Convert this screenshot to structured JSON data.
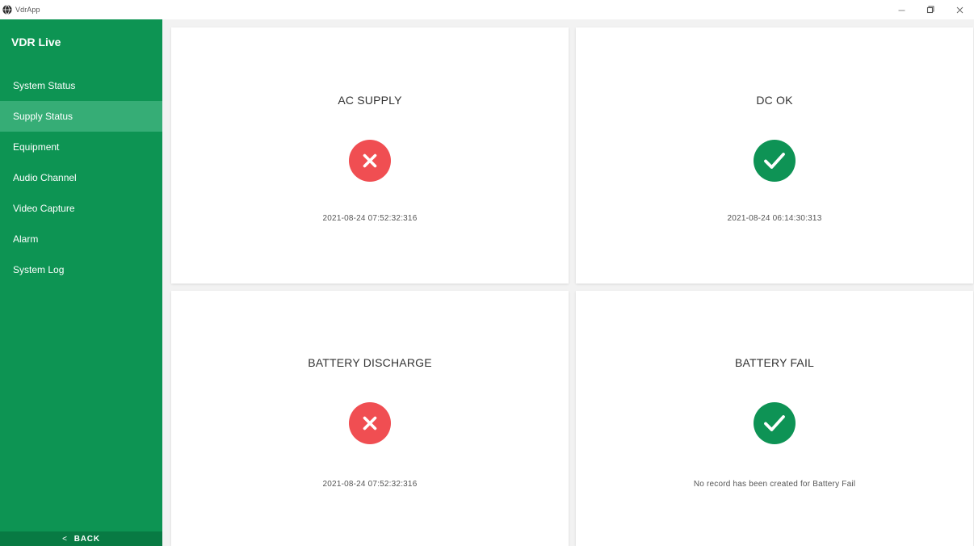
{
  "window": {
    "app_title": "VdrApp",
    "minimize_symbol": "—",
    "close_symbol": "×"
  },
  "sidebar": {
    "title": "VDR Live",
    "items": [
      {
        "label": "System Status"
      },
      {
        "label": "Supply Status"
      },
      {
        "label": "Equipment"
      },
      {
        "label": "Audio Channel"
      },
      {
        "label": "Video Capture"
      },
      {
        "label": "Alarm"
      },
      {
        "label": "System Log"
      }
    ],
    "active_item": "Supply Status",
    "back": {
      "chevron": "<",
      "label": "BACK"
    }
  },
  "cards": [
    {
      "title": "AC SUPPLY",
      "status": "error",
      "icon": "x-circle-icon",
      "timestamp": "2021-08-24 07:52:32:316"
    },
    {
      "title": "DC OK",
      "status": "ok",
      "icon": "check-circle-icon",
      "timestamp": "2021-08-24 06:14:30:313"
    },
    {
      "title": "BATTERY DISCHARGE",
      "status": "error",
      "icon": "x-circle-icon",
      "timestamp": "2021-08-24 07:52:32:316"
    },
    {
      "title": "BATTERY FAIL",
      "status": "ok",
      "icon": "check-circle-icon",
      "timestamp": "No record has been created for Battery Fail"
    }
  ],
  "colors": {
    "sidebar_bg": "#0d9453",
    "sidebar_active": "#36ad76",
    "back_bg": "#087a43",
    "error": "#f04e52",
    "ok": "#0e9355"
  }
}
